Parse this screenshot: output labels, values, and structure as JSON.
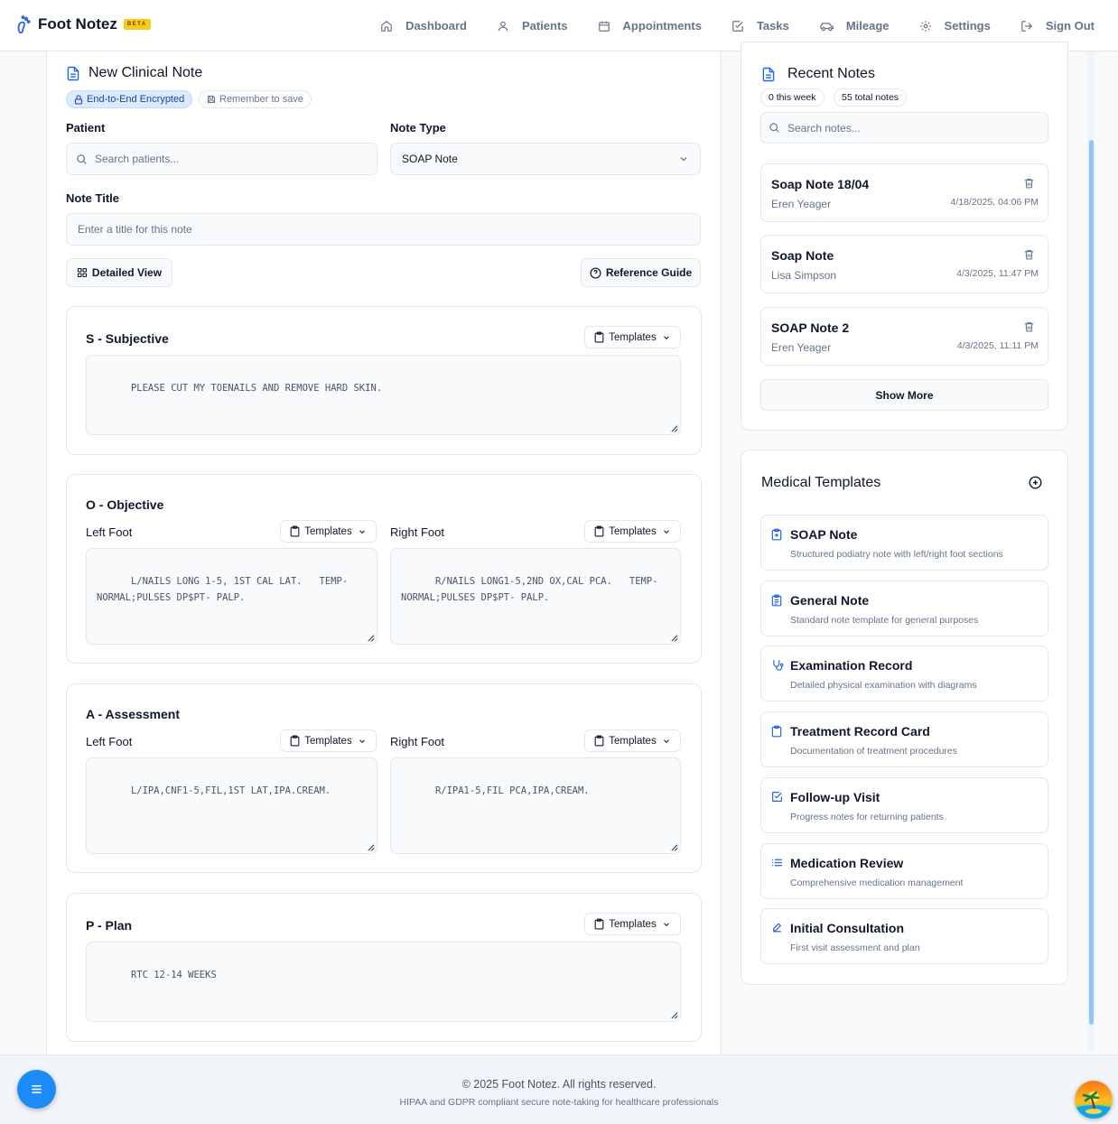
{
  "colors": {
    "accent": "#2563eb",
    "fab": "#1d8cf8",
    "beta": "#facc15",
    "scroll": "#93c5fd"
  },
  "brand": {
    "name": "Foot Notez",
    "badge": "BETA",
    "icon": "footprint-icon"
  },
  "nav": [
    {
      "label": "Dashboard",
      "icon": "home-icon"
    },
    {
      "label": "Patients",
      "icon": "user-icon"
    },
    {
      "label": "Appointments",
      "icon": "calendar-icon"
    },
    {
      "label": "Tasks",
      "icon": "checkbox-icon"
    },
    {
      "label": "Mileage",
      "icon": "car-icon"
    },
    {
      "label": "Settings",
      "icon": "gear-icon"
    },
    {
      "label": "Sign Out",
      "icon": "logout-icon"
    }
  ],
  "note_form": {
    "title": "New Clinical Note",
    "encrypted_badge": "End-to-End Encrypted",
    "save_badge": "Remember to save",
    "patient_label": "Patient",
    "patient_placeholder": "Search patients...",
    "note_type_label": "Note Type",
    "note_type_value": "SOAP Note",
    "note_title_label": "Note Title",
    "note_title_placeholder": "Enter a title for this note",
    "detailed_view_label": "Detailed View",
    "reference_guide_label": "Reference Guide",
    "templates_label": "Templates",
    "left_foot_label": "Left Foot",
    "right_foot_label": "Right Foot",
    "sections": {
      "subjective": {
        "title": "S - Subjective",
        "text": "PLEASE CUT MY TOENAILS AND REMOVE HARD SKIN."
      },
      "objective": {
        "title": "O - Objective",
        "left": "L/NAILS LONG 1-5, 1ST CAL LAT.   TEMP-NORMAL;PULSES DP$PT- PALP.",
        "right": "R/NAILS LONG1-5,2ND OX,CAL PCA.   TEMP-NORMAL;PULSES DP$PT- PALP."
      },
      "assessment": {
        "title": "A - Assessment",
        "left": "L/IPA,CNF1-5,FIL,1ST LAT,IPA.CREAM.",
        "right": "R/IPA1-5,FIL PCA,IPA,CREAM."
      },
      "plan": {
        "title": "P - Plan",
        "text": "RTC 12-14 WEEKS"
      }
    }
  },
  "recent_notes": {
    "title": "Recent Notes",
    "this_week": "0 this week",
    "total": "55 total notes",
    "search_placeholder": "Search notes...",
    "items": [
      {
        "title": "Soap Note 18/04",
        "patient": "Eren Yeager",
        "date": "4/18/2025, 04:06 PM"
      },
      {
        "title": "Soap Note",
        "patient": "Lisa Simpson",
        "date": "4/3/2025, 11:47 PM"
      },
      {
        "title": "SOAP Note 2",
        "patient": "Eren Yeager",
        "date": "4/3/2025, 11:11 PM"
      }
    ],
    "show_more": "Show More"
  },
  "templates": {
    "title": "Medical Templates",
    "items": [
      {
        "name": "SOAP Note",
        "desc": "Structured podiatry note with left/right foot sections",
        "icon": "clipboard-plus-icon"
      },
      {
        "name": "General Note",
        "desc": "Standard note template for general purposes",
        "icon": "clipboard-list-icon"
      },
      {
        "name": "Examination Record",
        "desc": "Detailed physical examination with diagrams",
        "icon": "stethoscope-icon"
      },
      {
        "name": "Treatment Record Card",
        "desc": "Documentation of treatment procedures",
        "icon": "clipboard-icon"
      },
      {
        "name": "Follow-up Visit",
        "desc": "Progress notes for returning patients",
        "icon": "check-square-icon"
      },
      {
        "name": "Medication Review",
        "desc": "Comprehensive medication management",
        "icon": "list-icon"
      },
      {
        "name": "Initial Consultation",
        "desc": "First visit assessment and plan",
        "icon": "pencil-icon"
      }
    ]
  },
  "footer": {
    "copyright": "© 2025 Foot Notez. All rights reserved.",
    "tagline": "HIPAA and GDPR compliant secure note-taking for healthcare professionals"
  }
}
